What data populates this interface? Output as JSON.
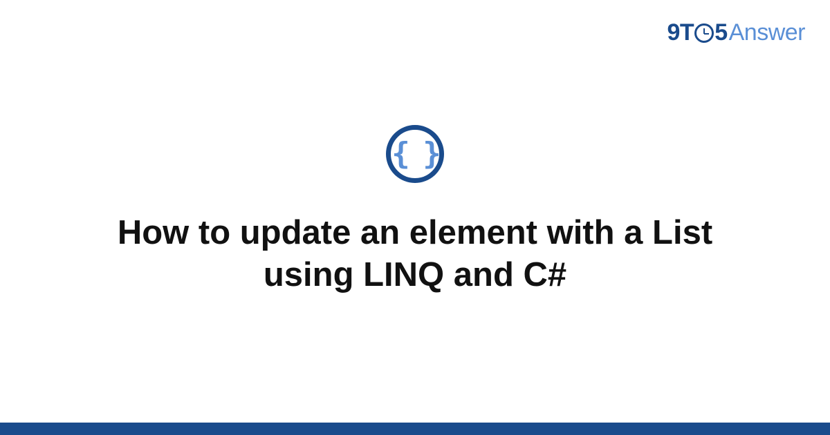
{
  "logo": {
    "part1": "9",
    "part2": "T",
    "part3": "5",
    "part4": "Answer"
  },
  "icon": {
    "glyph": "{ }",
    "name": "code-braces"
  },
  "title": "How to update an element with a List using LINQ and C#",
  "colors": {
    "primary": "#1a4b8c",
    "accent": "#5a8fd6"
  }
}
